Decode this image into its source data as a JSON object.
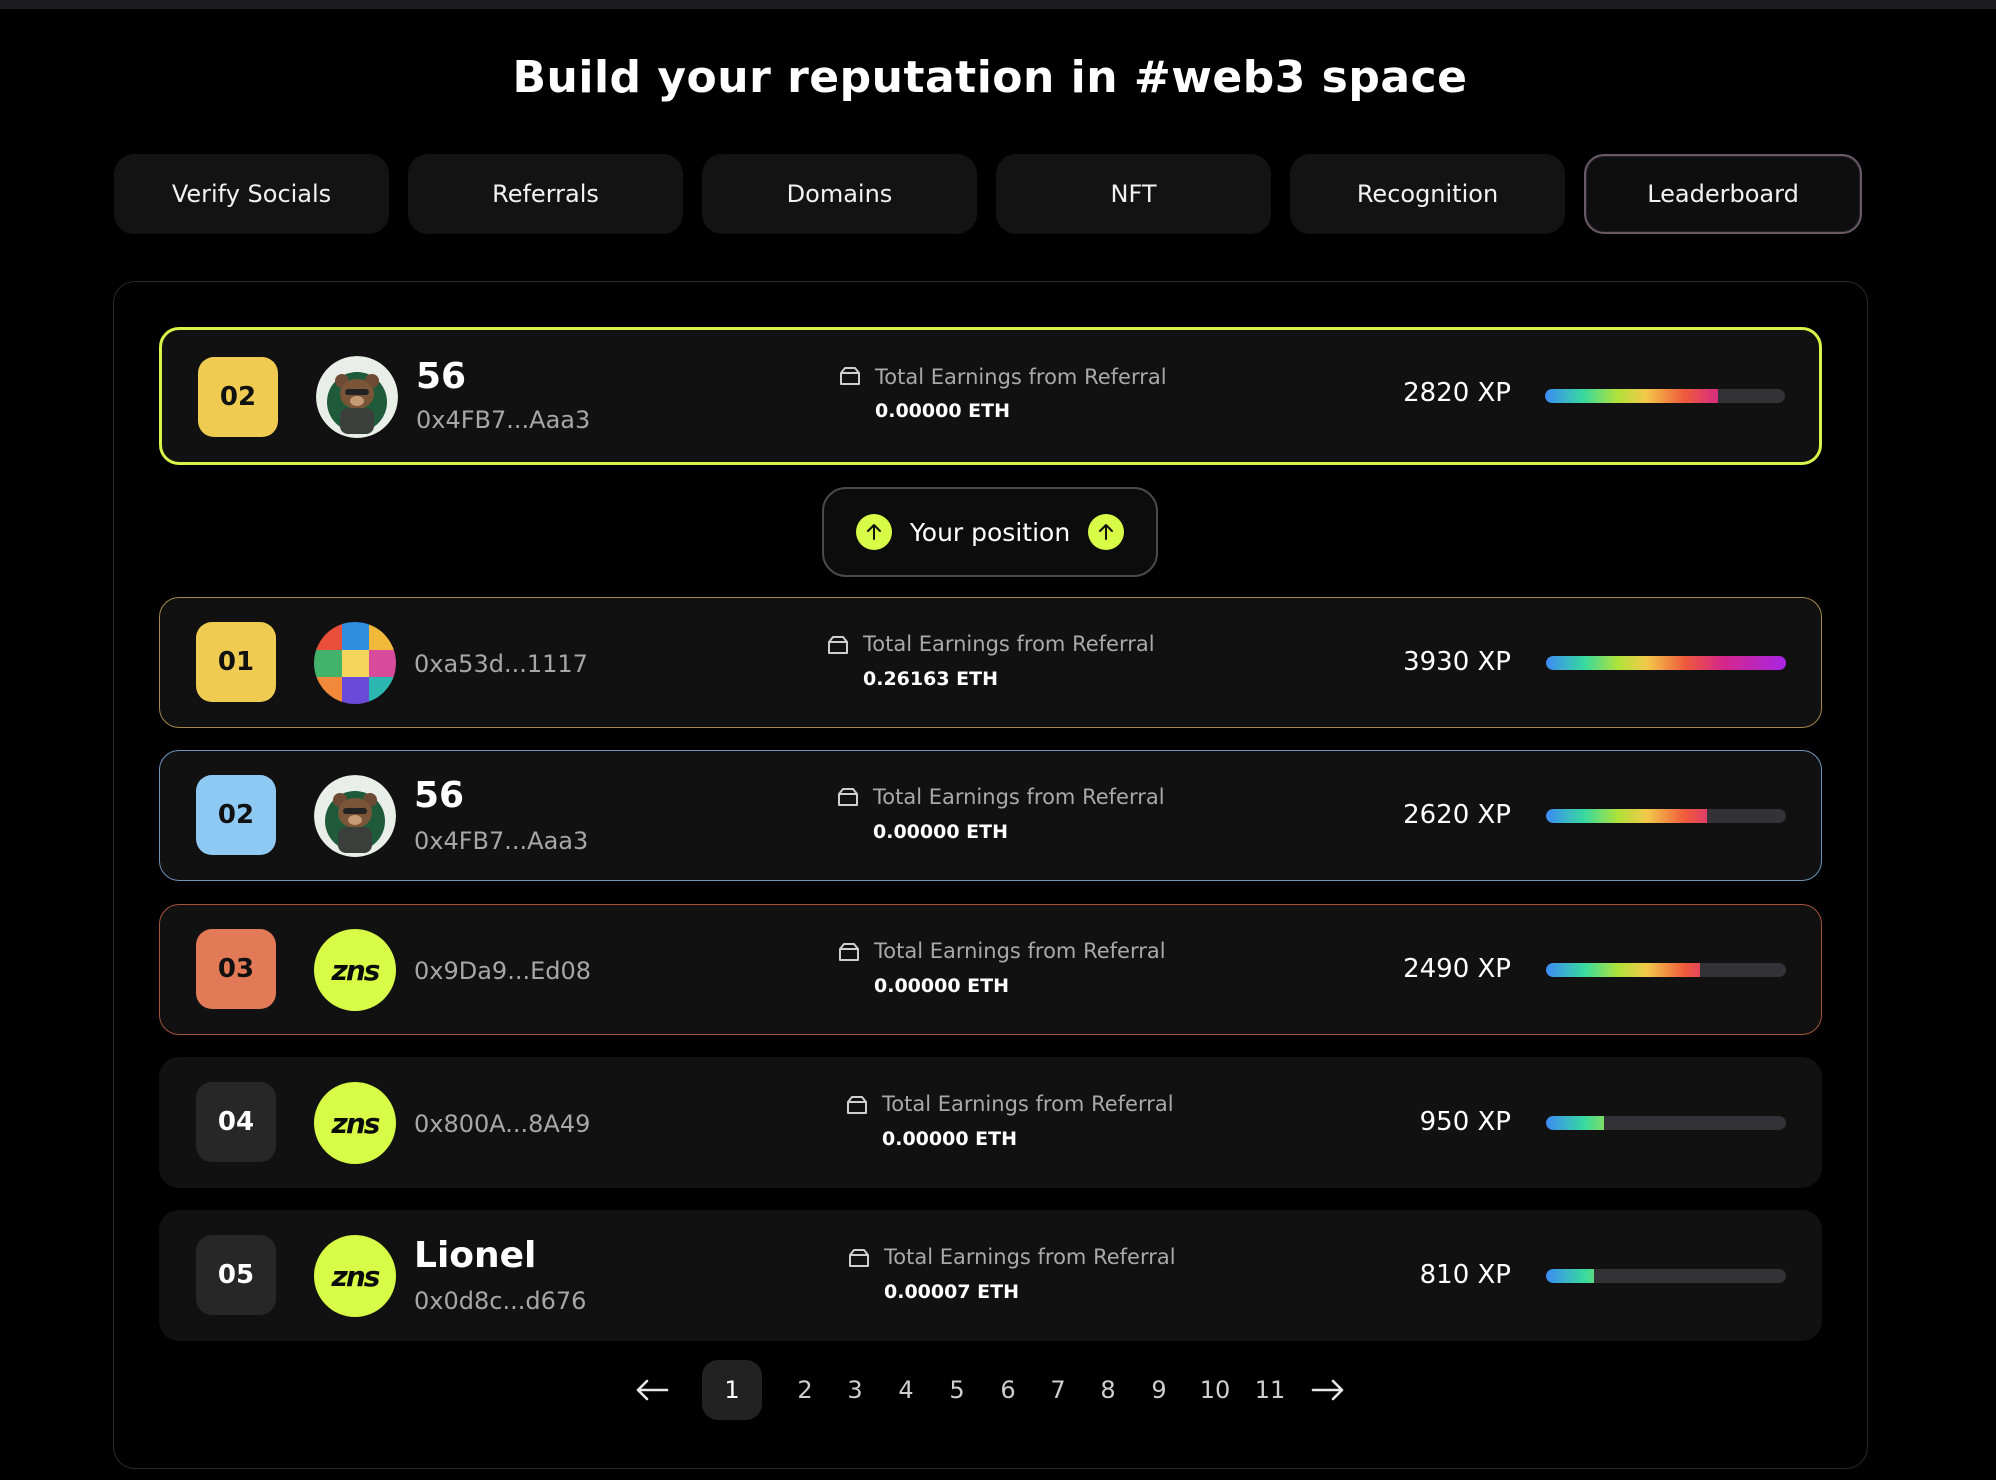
{
  "header": {
    "title": "Build your reputation in #web3 space"
  },
  "tabs": [
    {
      "label": "Verify Socials"
    },
    {
      "label": "Referrals"
    },
    {
      "label": "Domains"
    },
    {
      "label": "NFT"
    },
    {
      "label": "Recognition"
    },
    {
      "label": "Leaderboard"
    }
  ],
  "active_tab": "Leaderboard",
  "current_user": {
    "rank": "02",
    "name": "56",
    "address": "0x4FB7...Aaa3",
    "earnings_label": "Total Earnings from Referral",
    "earnings": "0.00000 ETH",
    "xp": "2820 XP",
    "xp_fraction": 0.72
  },
  "your_position_label": "Your position",
  "leaderboard": [
    {
      "rank": "01",
      "name": "",
      "address": "0xa53d...1117",
      "earnings_label": "Total Earnings from Referral",
      "earnings": "0.26163 ETH",
      "xp": "3930 XP",
      "xp_fraction": 1.0,
      "avatar": "nft-collage"
    },
    {
      "rank": "02",
      "name": "56",
      "address": "0x4FB7...Aaa3",
      "earnings_label": "Total Earnings from Referral",
      "earnings": "0.00000 ETH",
      "xp": "2620 XP",
      "xp_fraction": 0.67,
      "avatar": "bear"
    },
    {
      "rank": "03",
      "name": "",
      "address": "0x9Da9...Ed08",
      "earnings_label": "Total Earnings from Referral",
      "earnings": "0.00000 ETH",
      "xp": "2490 XP",
      "xp_fraction": 0.64,
      "avatar": "zns"
    },
    {
      "rank": "04",
      "name": "",
      "address": "0x800A...8A49",
      "earnings_label": "Total Earnings from Referral",
      "earnings": "0.00000 ETH",
      "xp": "950 XP",
      "xp_fraction": 0.24,
      "avatar": "zns"
    },
    {
      "rank": "05",
      "name": "Lionel",
      "address": "0x0d8c...d676",
      "earnings_label": "Total Earnings from Referral",
      "earnings": "0.00007 ETH",
      "xp": "810 XP",
      "xp_fraction": 0.2,
      "avatar": "zns"
    }
  ],
  "zns_logo_text": "zns",
  "pagination": {
    "current": "1",
    "pages": [
      "1",
      "2",
      "3",
      "4",
      "5",
      "6",
      "7",
      "8",
      "9",
      "10",
      "11"
    ],
    "prev_icon": "arrow-left-icon",
    "next_icon": "arrow-right-icon"
  },
  "colors": {
    "accent_lime": "#d7fb46",
    "rank_gold": "#efcb52",
    "rank_blue": "#8ec9f4",
    "rank_orange": "#e27a58",
    "rank_gray": "#272727"
  }
}
